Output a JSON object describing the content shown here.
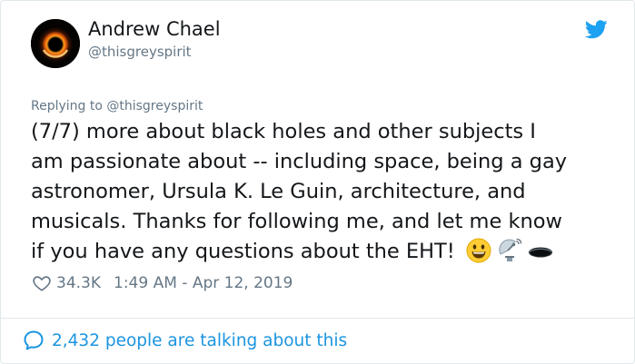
{
  "author": {
    "name": "Andrew Chael",
    "handle": "@thisgreyspirit"
  },
  "tweet": {
    "replying_to": "Replying to @thisgreyspirit",
    "lines": [
      "(7/7) more about black holes and other subjects I",
      "am passionate about -- including space, being a gay",
      "astronomer, Ursula K. Le Guin, architecture, and",
      "musicals. Thanks for following me, and let me know",
      "if you have any questions about the EHT!"
    ],
    "emojis": [
      "grinning-face-emoji",
      "satellite-antenna-emoji",
      "hole-emoji"
    ],
    "likes": "34.3K",
    "timestamp": "1:49 AM - Apr 12, 2019"
  },
  "footer": {
    "conversation": "2,432 people are talking about this"
  },
  "colors": {
    "text": "#14171a",
    "secondary": "#657786",
    "brand_blue": "#1da1f2",
    "link_blue": "#1b95e0",
    "border": "#e1e8ed"
  }
}
